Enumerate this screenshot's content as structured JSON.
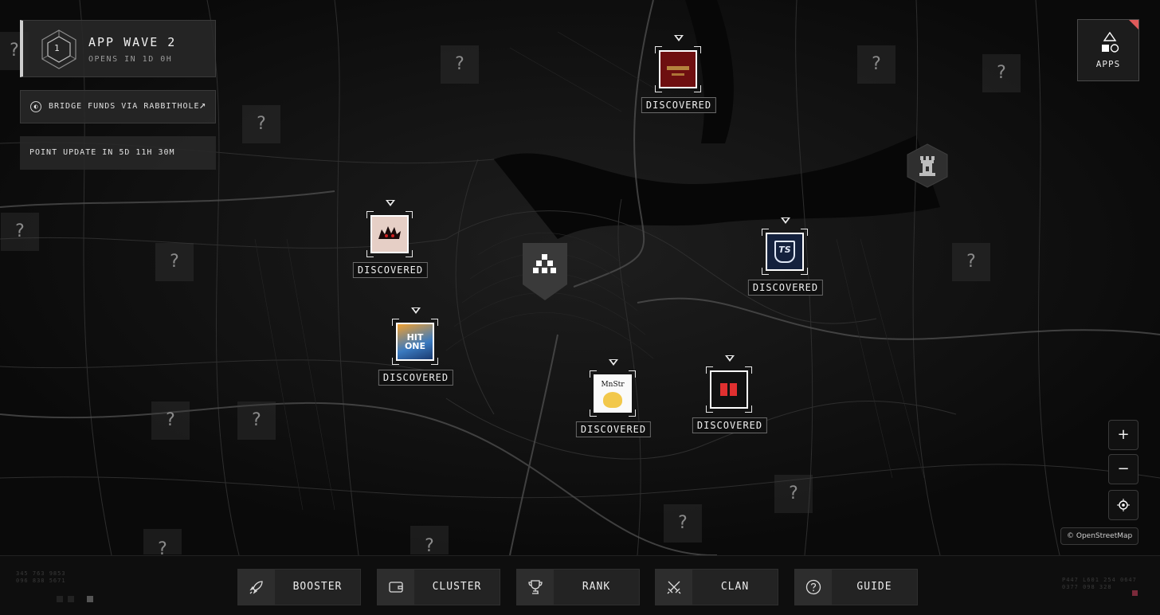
{
  "wave": {
    "number": "1",
    "title": "APP WAVE 2",
    "subtitle": "OPENS IN 1D 0H"
  },
  "bridge": {
    "label": "BRIDGE FUNDS VIA RABBITHOLE",
    "icon": "rabbithole-icon"
  },
  "points": {
    "label": "POINT UPDATE IN 5D 11H 30M"
  },
  "apps": {
    "label": "APPS"
  },
  "unknown_label": "?",
  "markers": [
    {
      "name": "marker-red-banner",
      "label": "DISCOVERED",
      "tile_color": "#6e0f10"
    },
    {
      "name": "marker-spiky-creature",
      "label": "DISCOVERED",
      "tile_color": "#e6cfc6"
    },
    {
      "name": "marker-hit-one",
      "label": "DISCOVERED",
      "tile_text": "HIT ONE"
    },
    {
      "name": "marker-mnstr",
      "label": "DISCOVERED",
      "tile_text": "MnStr"
    },
    {
      "name": "marker-rr",
      "label": "DISCOVERED",
      "tile_color": "#111111"
    },
    {
      "name": "marker-ts",
      "label": "DISCOVERED",
      "tile_text": "TS",
      "tile_color": "#14213d"
    }
  ],
  "zoom": {
    "in": "+",
    "out": "−",
    "locate_icon": "crosshair-icon"
  },
  "attribution": "© OpenStreetMap",
  "nav": [
    {
      "label": "BOOSTER",
      "icon": "rocket-icon"
    },
    {
      "label": "CLUSTER",
      "icon": "wallet-icon"
    },
    {
      "label": "RANK",
      "icon": "trophy-icon"
    },
    {
      "label": "CLAN",
      "icon": "crossed-swords-icon"
    },
    {
      "label": "GUIDE",
      "icon": "question-circle-icon"
    }
  ],
  "coords_left": [
    "345 763 9853",
    "096 838 5671"
  ],
  "coords_right": [
    "P447 L601 254 0647",
    "0377 098 328"
  ],
  "colors": {
    "accent": "#e05a5a",
    "background": "#0b0b0b"
  }
}
